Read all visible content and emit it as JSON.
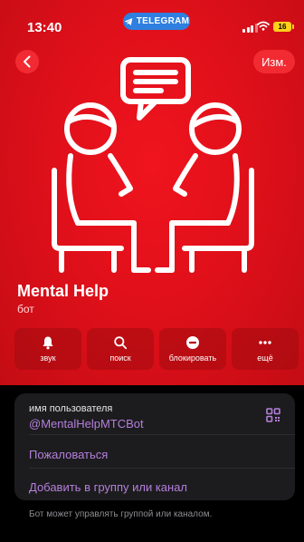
{
  "status_bar": {
    "time": "13:40",
    "app_pill": "TELEGRAM",
    "battery": "16"
  },
  "header": {
    "edit_label": "Изм."
  },
  "profile": {
    "name": "Mental Help",
    "subtitle": "бот"
  },
  "actions": [
    {
      "label": "звук",
      "icon": "bell-icon"
    },
    {
      "label": "поиск",
      "icon": "search-icon"
    },
    {
      "label": "блокировать",
      "icon": "block-icon"
    },
    {
      "label": "ещё",
      "icon": "more-icon"
    }
  ],
  "info": {
    "username_label": "имя пользователя",
    "username_value": "@MentalHelpMTCBot",
    "report_label": "Пожаловаться",
    "add_label": "Добавить в группу или канал"
  },
  "footnote": "Бот может управлять группой или каналом.",
  "colors": {
    "accent": "#e0101a",
    "link": "#b57fdc",
    "card": "#1c1c1e"
  }
}
